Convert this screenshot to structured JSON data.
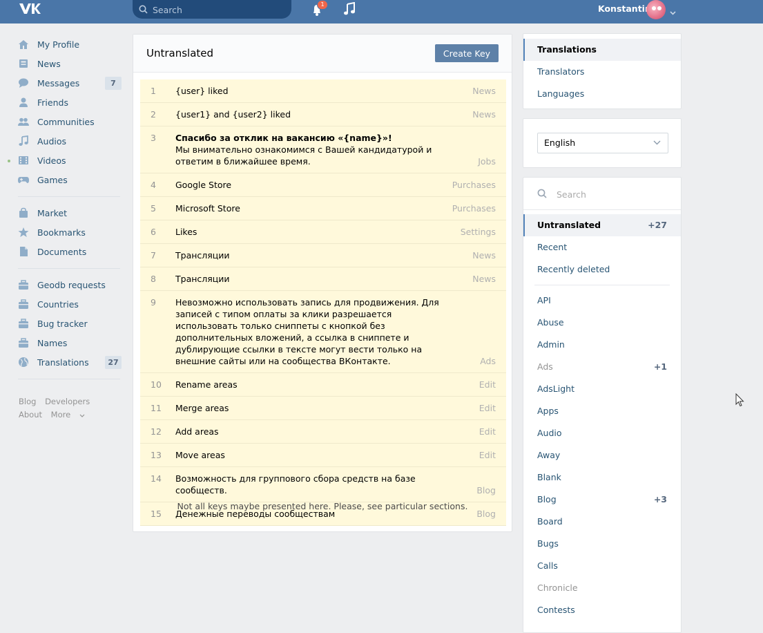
{
  "header": {
    "search_placeholder": "Search",
    "notification_count": "1",
    "user_name": "Konstantin"
  },
  "leftnav": {
    "items": [
      {
        "label": "My Profile",
        "icon": "home-icon"
      },
      {
        "label": "News",
        "icon": "news-icon"
      },
      {
        "label": "Messages",
        "icon": "chat-icon",
        "count": "7"
      },
      {
        "label": "Friends",
        "icon": "person-icon"
      },
      {
        "label": "Communities",
        "icon": "group-icon"
      },
      {
        "label": "Audios",
        "icon": "music-note-icon"
      },
      {
        "label": "Videos",
        "icon": "film-icon"
      },
      {
        "label": "Games",
        "icon": "gamepad-icon"
      }
    ],
    "items2": [
      {
        "label": "Market",
        "icon": "bag-icon"
      },
      {
        "label": "Bookmarks",
        "icon": "star-icon"
      },
      {
        "label": "Documents",
        "icon": "document-icon"
      }
    ],
    "items3": [
      {
        "label": "Geodb requests",
        "icon": "app-icon"
      },
      {
        "label": "Countries",
        "icon": "app-icon"
      },
      {
        "label": "Bug tracker",
        "icon": "app-icon"
      },
      {
        "label": "Names",
        "icon": "app-icon"
      },
      {
        "label": "Translations",
        "icon": "globe-icon",
        "count": "27"
      }
    ],
    "footer": {
      "blog": "Blog",
      "developers": "Developers",
      "about": "About",
      "more": "More"
    }
  },
  "main": {
    "title": "Untranslated",
    "create_button": "Create Key",
    "rows": [
      {
        "num": "1",
        "text": "{user} liked",
        "category": "News"
      },
      {
        "num": "2",
        "text": "{user1} and {user2} liked",
        "category": "News"
      },
      {
        "num": "3",
        "bold": "Спасибо за отклик на вакансию «{name}»!",
        "text": "Мы внимательно ознакомимся с Вашей кандидатурой и ответим в ближайшее время.",
        "category": "Jobs"
      },
      {
        "num": "4",
        "text": "Google Store",
        "category": "Purchases"
      },
      {
        "num": "5",
        "text": "Microsoft Store",
        "category": "Purchases"
      },
      {
        "num": "6",
        "text": "Likes",
        "category": "Settings"
      },
      {
        "num": "7",
        "text": "Трансляции",
        "category": "News"
      },
      {
        "num": "8",
        "text": "Трансляции",
        "category": "News"
      },
      {
        "num": "9",
        "text": "Невозможно использовать запись для продвижения. Для записей с типом оплаты за клики разрешается использовать только сниппеты с кнопкой без дополнительных вложений, а ссылка в сниппете и дублирующие ссылки в тексте могут вести только на внешние сайты или на сообщества ВКонтакте.",
        "category": "Ads"
      },
      {
        "num": "10",
        "text": "Rename areas",
        "category": "Edit"
      },
      {
        "num": "11",
        "text": "Merge areas",
        "category": "Edit"
      },
      {
        "num": "12",
        "text": "Add areas",
        "category": "Edit"
      },
      {
        "num": "13",
        "text": "Move areas",
        "category": "Edit"
      },
      {
        "num": "14",
        "text": "Возможность для группового сбора средств на базе сообществ.",
        "category": "Blog"
      },
      {
        "num": "15",
        "text": "Денежные переводы сообществам",
        "category": "Blog"
      }
    ],
    "note": "Not all keys maybe presented here. Please, see particular sections."
  },
  "right": {
    "menu": [
      {
        "label": "Translations",
        "active": true
      },
      {
        "label": "Translators"
      },
      {
        "label": "Languages"
      }
    ],
    "language": "English",
    "search_placeholder": "Search",
    "filters": [
      {
        "label": "Untranslated",
        "count": "+27",
        "active": true
      },
      {
        "label": "Recent"
      },
      {
        "label": "Recently deleted"
      }
    ],
    "sections": [
      {
        "label": "API"
      },
      {
        "label": "Abuse"
      },
      {
        "label": "Admin"
      },
      {
        "label": "Ads",
        "count": "+1",
        "muted": true
      },
      {
        "label": "AdsLight"
      },
      {
        "label": "Apps"
      },
      {
        "label": "Audio"
      },
      {
        "label": "Away"
      },
      {
        "label": "Blank"
      },
      {
        "label": "Blog",
        "count": "+3"
      },
      {
        "label": "Board"
      },
      {
        "label": "Bugs"
      },
      {
        "label": "Calls"
      },
      {
        "label": "Chronicle",
        "muted": true
      },
      {
        "label": "Contests"
      }
    ]
  },
  "colors": {
    "header": "#4a76a8",
    "accent": "#5181b8",
    "row_highlight": "#fff9db",
    "link": "#285473"
  }
}
